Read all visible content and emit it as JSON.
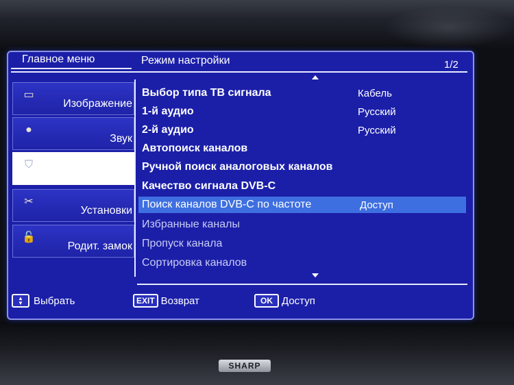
{
  "header": {
    "main_menu": "Главное меню",
    "section_title": "Режим настройки",
    "page_indicator": "1/2"
  },
  "sidebar": {
    "items": [
      {
        "label": "Изображение",
        "icon": "tv-icon",
        "glyph": "▭",
        "active": false
      },
      {
        "label": "Звук",
        "icon": "speaker-icon",
        "glyph": "●",
        "active": false
      },
      {
        "label": "",
        "icon": "shield-icon",
        "glyph": "⛉",
        "active": true
      },
      {
        "label": "Установки",
        "icon": "wrench-icon",
        "glyph": "✂",
        "active": false
      },
      {
        "label": "Родит. замок",
        "icon": "lock-icon",
        "glyph": "🔓",
        "active": false
      }
    ]
  },
  "menu": {
    "rows": [
      {
        "label": "Выбор типа ТВ сигнала",
        "value": "Кабель"
      },
      {
        "label": "1-й аудио",
        "value": "Русский"
      },
      {
        "label": "2-й аудио",
        "value": "Русский"
      },
      {
        "label": "Автопоиск каналов",
        "value": ""
      },
      {
        "label": "Ручной поиск аналоговых каналов",
        "value": ""
      },
      {
        "label": "Качество сигнала DVB-C",
        "value": ""
      },
      {
        "label": "Поиск каналов DVB-C по частоте",
        "value": "Доступ"
      },
      {
        "label": "Избранные каналы",
        "value": ""
      },
      {
        "label": "Пропуск канала",
        "value": ""
      },
      {
        "label": "Сортировка каналов",
        "value": ""
      }
    ]
  },
  "footer": {
    "select_label": "Выбрать",
    "exit_key": "EXIT",
    "exit_label": "Возврат",
    "ok_key": "OK",
    "ok_label": "Доступ"
  },
  "brand": "SHARP",
  "colors": {
    "osd_background": "#1b1fa8",
    "selected_row": "#3e6fe0",
    "border": "#8c93e8"
  }
}
